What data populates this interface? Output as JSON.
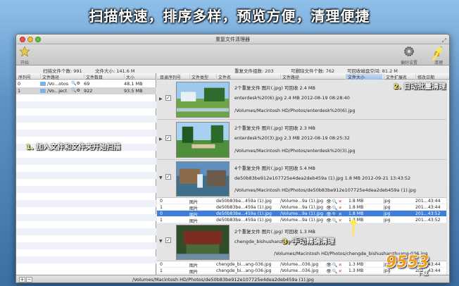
{
  "banner": "扫描快速，排序多样，预览方便，清理便捷",
  "window": {
    "title": "重复文件清理器"
  },
  "toolbar": {
    "start_label": "开始",
    "prefs_label": "偏好设置",
    "clean_label": "清理"
  },
  "status": {
    "scan_count": "扫描文件个数: 991",
    "file_size": "文件大小: 141.6 M",
    "dup_groups": "重复文件组数: 203",
    "deletable": "可删除文件个数: 762",
    "reclaimable": "可回收磁盘空间: 81.2 M"
  },
  "left_table": {
    "headers": [
      "序列号",
      "文件路径",
      "文件数目",
      "大小"
    ],
    "rows": [
      {
        "idx": "0",
        "path": "/Vo...otos",
        "count": "69",
        "size": "48.1 MB"
      },
      {
        "idx": "1",
        "path": "/Vo...ject",
        "count": "922",
        "size": "93.5 MB"
      }
    ]
  },
  "right_table": {
    "headers": [
      "目录序列号",
      "文件类型",
      "文件名",
      "文件路径",
      "文件大小",
      "文件扩展名",
      "修改日期"
    ]
  },
  "groups": [
    {
      "summary": "2个重复文件   图片(.jpg)   可回收 2.4 MB",
      "name_line": "enterdesk%20(6).jpg     2.4 MB     2012-08-19  08:28:40",
      "path": "/Volumes/Macintosh HD/Photos/enterdesk%20(6).jpg"
    },
    {
      "summary": "2个重复文件   图片(.jpg)   可回收 2.3 MB",
      "name_line": "enterdesk%20(3).jpg     2.3 MB     2012-08-19  08:25:32",
      "path": "/Volumes/Macintosh HD/Photos/enterdesk%20(3).jpg"
    },
    {
      "summary": "4个重复文件   图片(.jpg)   可回收 5.4 MB",
      "name_line": "de50b83be912e107725e4dea2deb459a (1).jpg     1.8 MB     2012-09-21  13:43:52",
      "path": "/Volumes/Macintosh HD/Photos/de50b83be912e107725e4dea2deb459a (1).jpg"
    },
    {
      "summary": "2个重复文件   图片(.jpg)   可回收 1.3 MB",
      "name_line": "chengde_bishushanzhuang-036.jpg",
      "path": "/Volumes/Macintosh HD/Photos/chengde_bishushanzhuang-036.jpg"
    }
  ],
  "file_rows_g3": [
    {
      "idx": "0",
      "type": "图片",
      "name": "de50b83be...459a (1).jpg",
      "path": "/Volume...9a (1).jpg",
      "size": "1.8 MB",
      "ext": "jpg",
      "date": "201...43:44"
    },
    {
      "idx": "1",
      "type": "图片",
      "name": "de50b83be...459a (1).jpg",
      "path": "/Volume...9a (1).jpg",
      "size": "1.8 MB",
      "ext": "jpg",
      "date": "201...43:44"
    },
    {
      "idx": "0",
      "type": "图片",
      "name": "de50b83be...459a (1).jpg",
      "path": "/Volume...9a (1).jpg",
      "size": "1.8 MB",
      "ext": "jpg",
      "date": "201...43:52"
    },
    {
      "idx": "1",
      "type": "图片",
      "name": "de50b83be...459a (1).jpg",
      "path": "/Volume...9a (1).jpg",
      "size": "1.8 MB",
      "ext": "jpg",
      "date": "201...43:52"
    }
  ],
  "file_rows_g4": [
    {
      "idx": "0",
      "type": "图片",
      "name": "chengde_bi...ang-036.jpg",
      "path": "/Volume...036.jpg",
      "size": "1.3 MB",
      "ext": "jpg",
      "date": "201...43:44"
    },
    {
      "idx": "1",
      "type": "图片",
      "name": "chengde_bi...ang-036.jpg",
      "path": "/Volume...036.jpg",
      "size": "1.3 MB",
      "ext": "jpg",
      "date": "201...43:44"
    }
  ],
  "row_actions": "👁🔍✕",
  "annotations": {
    "scan_note_num": "1.",
    "scan_note": "加入文件和文件夹开始扫描",
    "auto_note_num": "2.",
    "auto_note": "自动批量清理",
    "manual_note_num": "3.",
    "manual_note": "手动精确清理"
  },
  "bottom": {
    "add": "+",
    "remove": "−",
    "path": "/Volumes/Macintosh HD/Photos/de50b83be912e107725e4dea2deb459a (1).jpg"
  },
  "watermark": {
    "brand": "9553",
    "sub": "下载"
  },
  "colors": {
    "selection": "#3d7ddc",
    "note_yellow": "#ffe94a",
    "brand_orange": "#f29a1b"
  }
}
